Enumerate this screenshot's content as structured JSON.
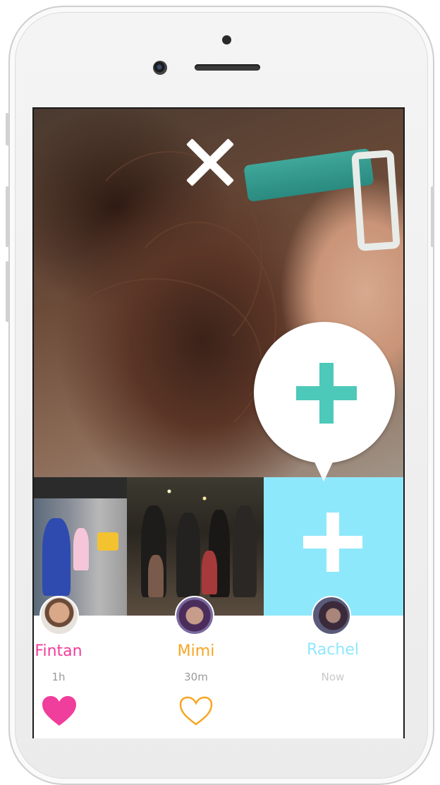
{
  "header": {
    "close_label": "close"
  },
  "friends": [
    {
      "name": "Fintan",
      "time": "1h",
      "color": "#f03e9c",
      "heart": "filled"
    },
    {
      "name": "Mimi",
      "time": "30m",
      "color": "#f5a623",
      "heart": "outline"
    },
    {
      "name": "Rachel",
      "time": "Now",
      "color": "#8ee8fb",
      "heart": "none"
    }
  ],
  "colors": {
    "accent_teal": "#4dc9b9",
    "tile_blue": "#8ee8fb",
    "heart_pink": "#f03e9c",
    "heart_orange": "#f5a623"
  },
  "icons": [
    "close-icon",
    "plus-icon",
    "heart-filled-icon",
    "heart-outline-icon"
  ]
}
